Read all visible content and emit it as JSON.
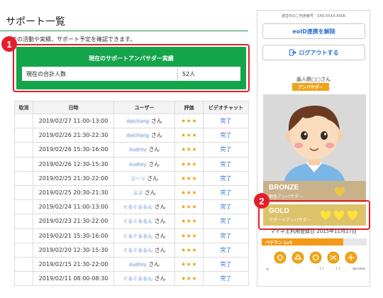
{
  "page": {
    "title": "サポート一覧",
    "description": "までの活動や実績、サポート予定を確認できます。"
  },
  "summary": {
    "heading": "現在のサポートアンバサダー実績",
    "label": "現在の合計人数",
    "value": "52人",
    "marker": "1"
  },
  "table": {
    "headers": [
      "取消",
      "日時",
      "ユーザー",
      "評価",
      "ビデオチャット"
    ],
    "rows": [
      {
        "datetime": "2019/02/27 11:00-13:00",
        "user": "daichang",
        "san": "さん",
        "rating": "★★★",
        "status": "完了"
      },
      {
        "datetime": "2019/02/26 21:30-22:30",
        "user": "daichang",
        "san": "さん",
        "rating": "★★★",
        "status": "完了"
      },
      {
        "datetime": "2019/02/26 15:30-16:00",
        "user": "Audrey",
        "san": "さん",
        "rating": "★★★",
        "status": "完了"
      },
      {
        "datetime": "2019/02/26 12:30-15:30",
        "user": "Audrey",
        "san": "さん",
        "rating": "★★★",
        "status": "完了"
      },
      {
        "datetime": "2019/02/25 21:30-22:00",
        "user": "ユーリ",
        "san": "さん",
        "rating": "★★★",
        "status": "完了"
      },
      {
        "datetime": "2019/02/25 20:30-21:30",
        "user": "ぶぶ",
        "san": "さん",
        "rating": "★★★",
        "status": "完了"
      },
      {
        "datetime": "2019/02/24 11:00-13:00",
        "user": "ぐるぐるるん",
        "san": "さん",
        "rating": "★★★",
        "status": "完了"
      },
      {
        "datetime": "2019/02/23 21:30-22:00",
        "user": "ぐるぐるるん",
        "san": "さん",
        "rating": "★★★",
        "status": "完了"
      },
      {
        "datetime": "2019/02/21 15:30-16:00",
        "user": "ぐるぐるるん",
        "san": "さん",
        "rating": "★★★",
        "status": "完了"
      },
      {
        "datetime": "2019/02/20 12:30-15:30",
        "user": "ぐるぐるるん",
        "san": "さん",
        "rating": "★★★",
        "status": "完了"
      },
      {
        "datetime": "2019/02/15 21:30-22:00",
        "user": "Audrey",
        "san": "さん",
        "rating": "★★★",
        "status": "完了"
      },
      {
        "datetime": "2019/02/11 08:00-08:30",
        "user": "ぐるぐるるん",
        "san": "さん",
        "rating": "★★★",
        "status": "完了"
      }
    ]
  },
  "sidebar": {
    "registration_number": "運営中のご利用番号：SXO-XXXX-X906",
    "eoid_button": "eoID連携を解除",
    "logout_button": "ログアウトする",
    "user_name": "晶人鼎□□",
    "user_suffix": "さん",
    "role_tag": "アンバサダー",
    "bronze_title": "BRONZE",
    "bronze_sub": "銅色アンバサダー",
    "gold_title": "GOLD",
    "gold_sub": "サポートアンバサダー",
    "gold_marker": "2",
    "registration_date": "マイネ王利用登録日 2015年11月17日",
    "level_label": "ベテラン Lv3",
    "level_progress": 0.78,
    "medal_labels": [
      "エ",
      "",
      "",
      "",
      "[ ]",
      "[ ]",
      "docomo"
    ]
  },
  "colors": {
    "accent_green": "#14a44a",
    "highlight_red": "#e51e2b",
    "link_blue": "#2a6fd0",
    "star_gold": "#e7a418",
    "bronze": "#c9b28a",
    "gold": "#dcc36a",
    "level_orange": "#f49a17"
  },
  "icons": [
    "logout-icon",
    "heart-icon",
    "medal-icon",
    "avatar-illustration"
  ]
}
